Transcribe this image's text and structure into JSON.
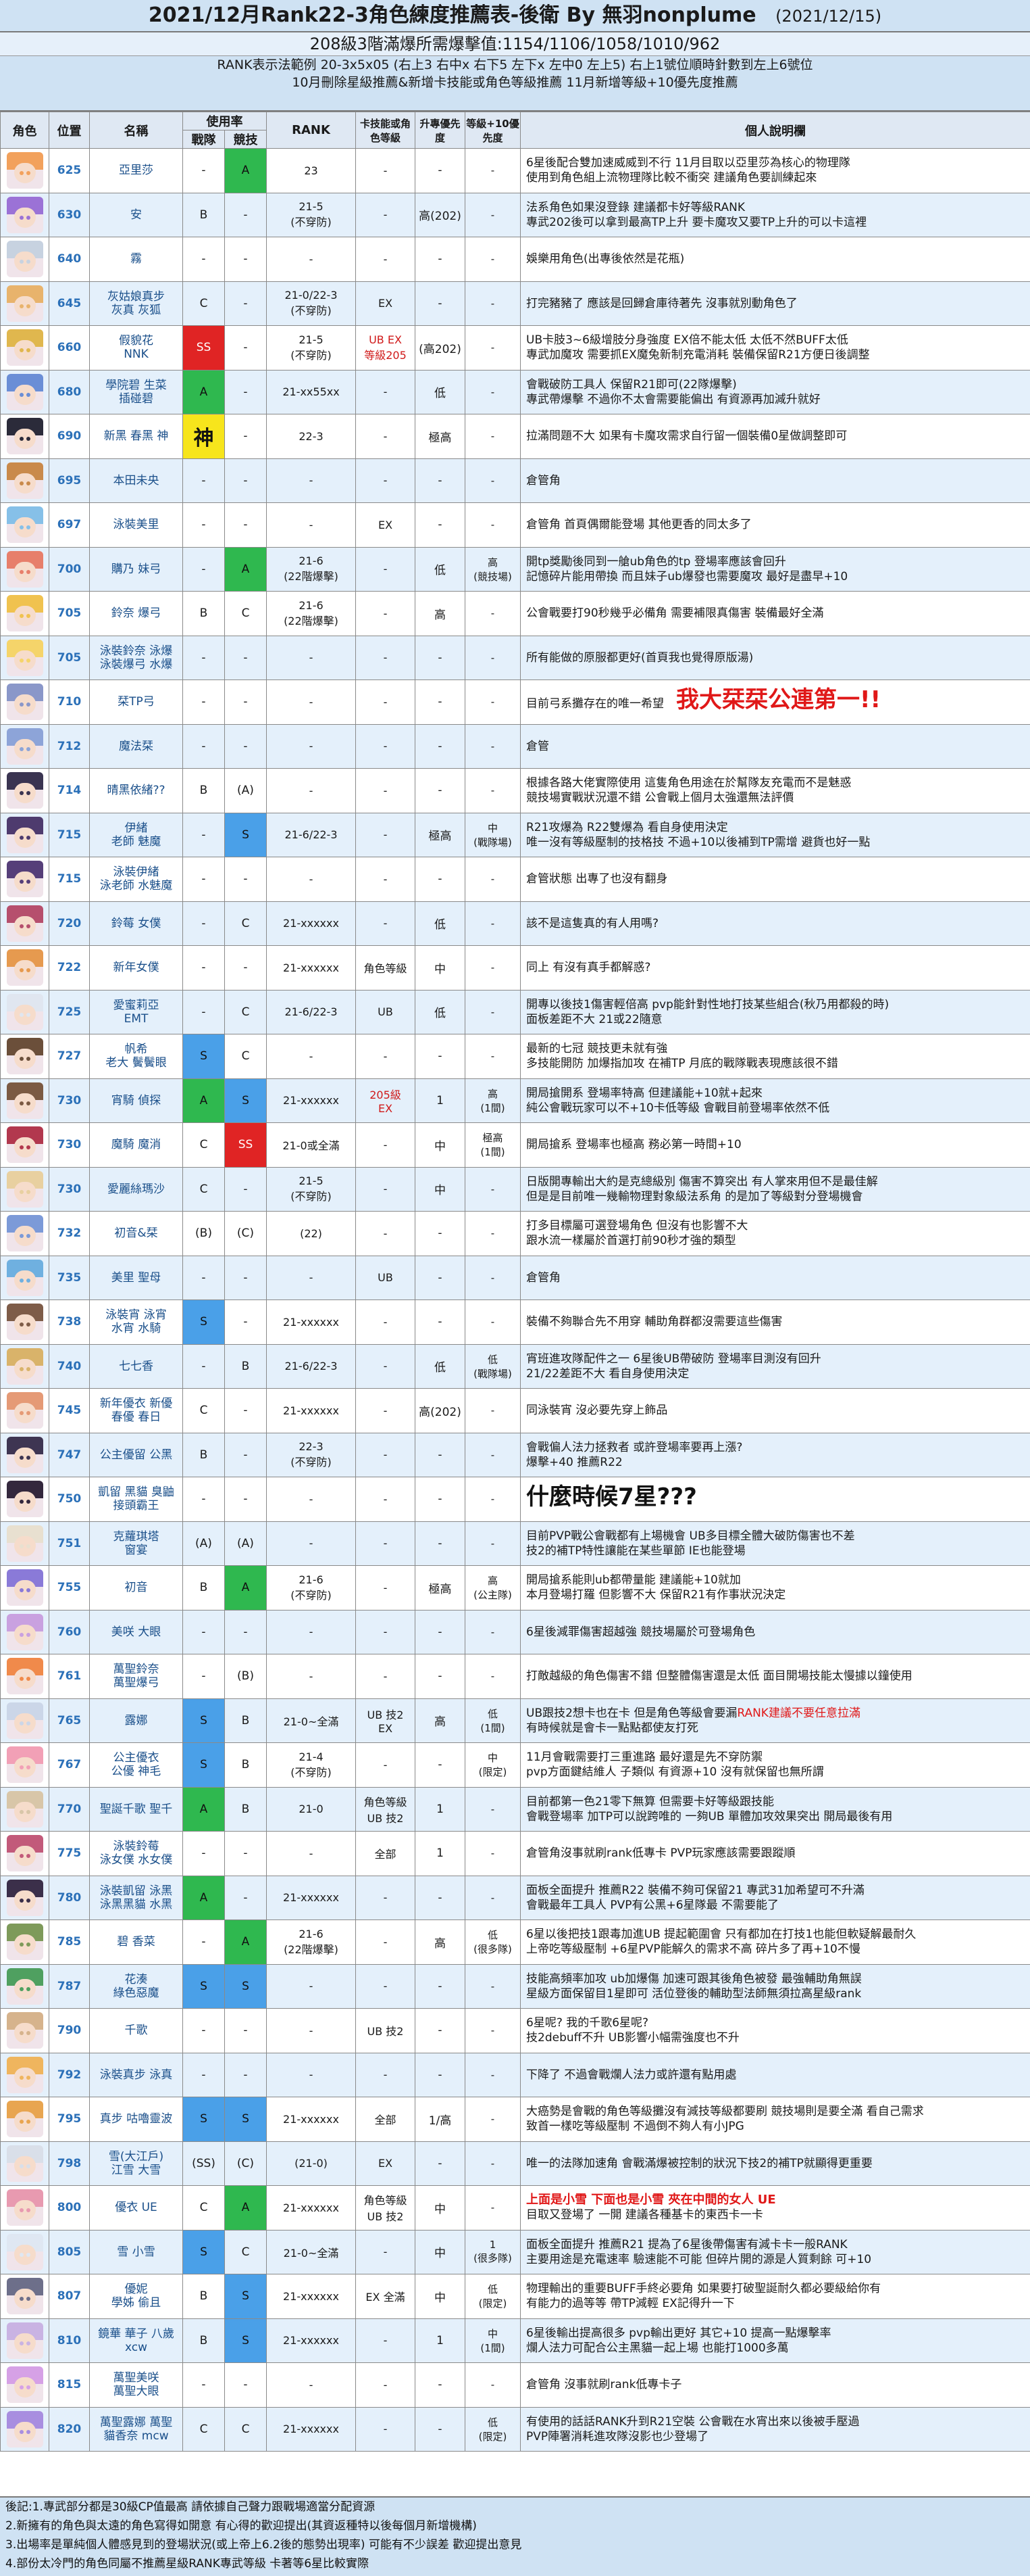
{
  "header": {
    "title": "2021/12月Rank22-3角色練度推薦表-後衛 By 無羽nonplume",
    "date": "(2021/12/15)",
    "subtitle": "208級3階滿爆所需爆擊值:1154/1106/1058/1010/962",
    "info_lines": [
      "RANK表示法範例 20-3x5x05 (右上3 右中x 右下5 左下x 左中0 左上5) 右上1號位順時針數到左上6號位",
      "10月刪除星級推薦&新增卡技能或角色等級推薦 11月新增等級+10優先度推薦"
    ]
  },
  "columns": {
    "avatar": "角色",
    "position": "位置",
    "name": "名稱",
    "usage": "使用率",
    "usage_battle": "戰隊",
    "usage_arena": "競技",
    "rank": "RANK",
    "card": "卡技能或角色等級",
    "uniq": "升專優先度",
    "lv10": "等級+10優先度",
    "note": "個人說明欄"
  },
  "rows": [
    {
      "pos": "625",
      "name": "亞里莎",
      "battle": "-",
      "arena": "A",
      "rank": "23",
      "card": "-",
      "uniq": "-",
      "lv10": "-",
      "note": "6星後配合雙加速威威到不行 11月目取以亞里莎為核心的物理隊\n使用到角色組上流物理隊比較不衝突 建議角色要訓練起來",
      "hair": "#f2a15c"
    },
    {
      "pos": "630",
      "name": "安",
      "battle": "B",
      "arena": "-",
      "rank": "21-5\n(不穿防)",
      "card": "-",
      "uniq": "高(202)",
      "lv10": "-",
      "note": "法系角色如果沒登錄 建議都卡好等級RANK\n專武202後可以拿到最高TP上升 要卡魔攻又要TP上升的可以卡這裡",
      "hair": "#9b72d6"
    },
    {
      "pos": "640",
      "name": "霧",
      "battle": "-",
      "arena": "-",
      "rank": "-",
      "card": "-",
      "uniq": "-",
      "lv10": "-",
      "note": "娛樂用角色(出專後依然是花瓶)",
      "hair": "#c7d2e0"
    },
    {
      "pos": "645",
      "name": "灰姑娘真步\n灰真 灰狐",
      "battle": "C",
      "arena": "-",
      "rank": "21-0/22-3\n(不穿防)",
      "card": "EX",
      "uniq": "-",
      "lv10": "-",
      "note": "打完豬豬了 應該是回歸倉庫待著先 沒事就別動角色了",
      "hair": "#e8b36c"
    },
    {
      "pos": "660",
      "name": "假貌花\nNNK",
      "battle": "SS",
      "arena": "-",
      "rank": "21-5\n(不穿防)",
      "card": "UB EX\n等級205",
      "uniq": "(高202)",
      "lv10": "-",
      "note": "UB卡肢3~6級增肢分身強度 EX倍不能太低 太低不然BUFF太低\n專武加魔攻 需要抓EX魔兔新制充電消耗 裝備保留R21方便日後調整",
      "hair": "#e0b74e"
    },
    {
      "pos": "680",
      "name": "學院碧 生菜\n插碰碧",
      "battle": "A",
      "arena": "-",
      "rank": "21-xx55xx",
      "card": "-",
      "uniq": "低",
      "lv10": "-",
      "note": "會戰破防工具人 保留R21即可(22隊爆擊)\n專武帶爆擊 不過你不太會需要能偏出 有資源再加減升就好",
      "hair": "#6a8ed6"
    },
    {
      "pos": "690",
      "name": "新黑 春黑 神",
      "battle": "神",
      "arena": "-",
      "rank": "22-3",
      "card": "-",
      "uniq": "極高",
      "lv10": "-",
      "note": "拉滿問題不大 如果有卡魔攻需求自行留一個裝備0星做調整即可",
      "hair": "#2b2b3a"
    },
    {
      "pos": "695",
      "name": "本田未央",
      "battle": "-",
      "arena": "-",
      "rank": "-",
      "card": "-",
      "uniq": "-",
      "lv10": "-",
      "note": "倉管角",
      "hair": "#c98a4b"
    },
    {
      "pos": "697",
      "name": "泳裝美里",
      "battle": "-",
      "arena": "-",
      "rank": "-",
      "card": "EX",
      "uniq": "-",
      "lv10": "-",
      "note": "倉管角 首頁偶爾能登場 其他更香的同太多了",
      "hair": "#86c0e8"
    },
    {
      "pos": "700",
      "name": "購乃 妹弓",
      "battle": "-",
      "arena": "A",
      "rank": "21-6\n(22階爆擊)",
      "card": "-",
      "uniq": "低",
      "lv10": "高\n(競技場)",
      "note": "開tp獎勵後同到一艙ub角色的tp 登場率應該會回升\n記憶碎片能用帶換 而且妹子ub爆發也需要魔攻 最好是盡早+10",
      "hair": "#e77f6b"
    },
    {
      "pos": "705",
      "name": "鈴奈 爆弓",
      "battle": "B",
      "arena": "C",
      "rank": "21-6\n(22階爆擊)",
      "card": "-",
      "uniq": "高",
      "lv10": "-",
      "note": "公會戰要打90秒幾乎必備角 需要補限真傷害 裝備最好全滿",
      "hair": "#f0c24f"
    },
    {
      "pos": "705",
      "name": "泳裝鈴奈 泳爆\n泳裝爆弓 水爆",
      "battle": "-",
      "arena": "-",
      "rank": "-",
      "card": "-",
      "uniq": "-",
      "lv10": "-",
      "note": "所有能做的原服都更好(首頁我也覺得原版湯)",
      "hair": "#f5d46a"
    },
    {
      "pos": "710",
      "name": "栞TP弓",
      "battle": "-",
      "arena": "-",
      "rank": "-",
      "card": "-",
      "uniq": "-",
      "lv10": "-",
      "note": "目前弓系攤存在的唯一希望",
      "bignote": "我大栞栞公連第一!!",
      "hair": "#8a97c9"
    },
    {
      "pos": "712",
      "name": "魔法栞",
      "battle": "-",
      "arena": "-",
      "rank": "-",
      "card": "-",
      "uniq": "-",
      "lv10": "-",
      "note": "倉管",
      "hair": "#8da4d8"
    },
    {
      "pos": "714",
      "name": "晴黑依緒??",
      "battle": "B",
      "arena": "(A)",
      "rank": "-",
      "card": "-",
      "uniq": "-",
      "lv10": "-",
      "note": "根據各路大佬實際使用 這隻角色用途在於幫隊友充電而不是魅惑\n競技場實戰狀況還不錯 公會戰上個月太強還無法評價",
      "hair": "#3a3451"
    },
    {
      "pos": "715",
      "name": "伊緒\n老師 魅魔",
      "battle": "-",
      "arena": "S",
      "rank": "21-6/22-3",
      "card": "-",
      "uniq": "極高",
      "lv10": "中\n(戰隊場)",
      "note": "R21攻爆為 R22雙爆為 看自身使用決定\n唯一沒有等級壓制的技格技 不過+10以後補到TP需增 避貨也好一點",
      "hair": "#4e3b6e"
    },
    {
      "pos": "715",
      "name": "泳裝伊緒\n泳老師 水魅魔",
      "battle": "-",
      "arena": "-",
      "rank": "-",
      "card": "-",
      "uniq": "-",
      "lv10": "-",
      "note": "倉管狀態 出專了也沒有翻身",
      "hair": "#563f79"
    },
    {
      "pos": "720",
      "name": "鈴莓 女僕",
      "battle": "-",
      "arena": "C",
      "rank": "21-xxxxxx",
      "card": "-",
      "uniq": "低",
      "lv10": "-",
      "note": "該不是這隻真的有人用嗎?",
      "hair": "#b64f6d"
    },
    {
      "pos": "722",
      "name": "新年女僕",
      "battle": "-",
      "arena": "-",
      "rank": "21-xxxxxx",
      "card": "角色等級",
      "uniq": "中",
      "lv10": "-",
      "note": "同上 有沒有真手都解惑?",
      "hair": "#e69a4f"
    },
    {
      "pos": "725",
      "name": "愛蜜莉亞\nEMT",
      "battle": "-",
      "arena": "C",
      "rank": "21-6/22-3",
      "card": "UB",
      "uniq": "低",
      "lv10": "-",
      "note": "開專以後技1傷害輕倍高 pvp能針對性地打技某些組合(秋乃用都殺的時)\n面板差距不大 21或22隨意",
      "hair": "#e0e6f0"
    },
    {
      "pos": "727",
      "name": "帆希\n老大 鬢鬢眼",
      "battle": "S",
      "arena": "C",
      "rank": "-",
      "card": "-",
      "uniq": "-",
      "lv10": "-",
      "note": "最新的七冠 競技更未就有強\n多技能開防 加爆指加攻 在補TP 月底的戰隊戰表現應該很不錯",
      "hair": "#6b4f3a"
    },
    {
      "pos": "730",
      "name": "宵騎 偵探",
      "battle": "A",
      "arena": "S",
      "rank": "21-xxxxxx",
      "card": "205級\nEX",
      "uniq": "1",
      "lv10": "高\n(1間)",
      "note": "開局搶開系 登場率特高 但建議能+10就+起來\n純公會戰玩家可以不+10卡低等級 會戰目前登場率依然不低",
      "hair": "#7b5a43"
    },
    {
      "pos": "730",
      "name": "魔騎 魔消",
      "battle": "C",
      "arena": "SS",
      "rank": "21-0或全滿",
      "card": "-",
      "uniq": "中",
      "lv10": "極高\n(1間)",
      "note": "開局搶系 登場率也極高 務必第一時間+10",
      "hair": "#b2384e"
    },
    {
      "pos": "730",
      "name": "愛麗絲瑪沙",
      "battle": "C",
      "arena": "-",
      "rank": "21-5\n(不穿防)",
      "card": "-",
      "uniq": "中",
      "lv10": "-",
      "note": "日版開專輸出大約是克總級別 傷害不算突出 有人掌來用但不是最佳解\n但是是目前唯一幾輸物理對象級法系角 的是加了等級對分登場機會",
      "hair": "#e8d0a0"
    },
    {
      "pos": "732",
      "name": "初音&栞",
      "battle": "(B)",
      "arena": "(C)",
      "rank": "(22)",
      "card": "-",
      "uniq": "-",
      "lv10": "-",
      "note": "打多目標屬可選登場角色 但沒有也影響不大\n跟水流一樣屬於首選打前90秒才強的類型",
      "hair": "#7c9ad8"
    },
    {
      "pos": "735",
      "name": "美里 聖母",
      "battle": "-",
      "arena": "-",
      "rank": "-",
      "card": "UB",
      "uniq": "-",
      "lv10": "-",
      "note": "倉管角",
      "hair": "#6fb0e0"
    },
    {
      "pos": "738",
      "name": "泳裝宵 泳宵\n水宵 水騎",
      "battle": "S",
      "arena": "-",
      "rank": "21-xxxxxx",
      "card": "-",
      "uniq": "-",
      "lv10": "-",
      "note": "裝備不夠聯合先不用穿 輔助角群都沒需要這些傷害",
      "hair": "#7e5c48"
    },
    {
      "pos": "740",
      "name": "七七香",
      "battle": "-",
      "arena": "B",
      "rank": "21-6/22-3",
      "card": "-",
      "uniq": "低",
      "lv10": "低\n(戰隊場)",
      "note": "宵班進攻隊配件之一 6星後UB帶破防 登場率目測沒有回升\n21/22差距不大 看自身使用決定",
      "hair": "#d9b36a"
    },
    {
      "pos": "745",
      "name": "新年優衣 新優\n春優 春日",
      "battle": "C",
      "arena": "-",
      "rank": "21-xxxxxx",
      "card": "-",
      "uniq": "高(202)",
      "lv10": "-",
      "note": "同泳裝宵 沒必要先穿上飾品",
      "hair": "#e59a76"
    },
    {
      "pos": "747",
      "name": "公主優留 公黑",
      "battle": "B",
      "arena": "-",
      "rank": "22-3\n(不穿防)",
      "card": "-",
      "uniq": "-",
      "lv10": "-",
      "note": "會戰偏人法力拯救者 或許登場率要再上漲?\n爆擊+40 推薦R22",
      "hair": "#3e3552"
    },
    {
      "pos": "750",
      "name": "凱留 黑貓 臭鼬\n接頭霸王",
      "battle": "-",
      "arena": "-",
      "rank": "-",
      "card": "-",
      "uniq": "-",
      "lv10": "-",
      "note": "",
      "bignote2": "什麼時候7星???",
      "hair": "#34283d"
    },
    {
      "pos": "751",
      "name": "克蘿琪塔\n窗宴",
      "battle": "(A)",
      "arena": "(A)",
      "rank": "-",
      "card": "-",
      "uniq": "-",
      "lv10": "-",
      "note": "目前PVP戰公會戰都有上場機會 UB多目標全體大破防傷害也不差\n技2的補TP特性讓能在某些單節 IE也能登場",
      "hair": "#e8e0d0"
    },
    {
      "pos": "755",
      "name": "初音",
      "battle": "B",
      "arena": "A",
      "rank": "21-6\n(不穿防)",
      "card": "-",
      "uniq": "極高",
      "lv10": "高\n(公主隊)",
      "note": "開局搶系能則ub都帶量能 建議能+10就加\n本月登場打羅 但影響不大 保留R21有作事狀況決定",
      "hair": "#8a7ad8"
    },
    {
      "pos": "760",
      "name": "美咲 大眼",
      "battle": "-",
      "arena": "-",
      "rank": "-",
      "card": "-",
      "uniq": "-",
      "lv10": "-",
      "note": "6星後減罪傷害超越強 競技場屬於可登場角色",
      "hair": "#c9a1e0"
    },
    {
      "pos": "761",
      "name": "萬聖鈴奈\n萬聖爆弓",
      "battle": "-",
      "arena": "(B)",
      "rank": "-",
      "card": "-",
      "uniq": "-",
      "lv10": "-",
      "note": "打敵越級的角色傷害不錯 但整體傷害還是太低 面目開場技能太慢據以鐘使用",
      "hair": "#f08a4b"
    },
    {
      "pos": "765",
      "name": "露娜",
      "battle": "S",
      "arena": "B",
      "rank": "21-0~全滿",
      "card": "UB 技2\nEX",
      "uniq": "高",
      "lv10": "低\n(1間)",
      "note": "UB跟技2想卡也在卡 但是角色等級會要漏",
      "rednote": "RANK建議不要任意拉滿",
      "note2": "有時候就是會卡一點點都使友打死",
      "hair": "#cbd6e8"
    },
    {
      "pos": "767",
      "name": "公主優衣\n公優 神毛",
      "battle": "S",
      "arena": "B",
      "rank": "21-4\n(不穿防)",
      "card": "-",
      "uniq": "-",
      "lv10": "中\n(限定)",
      "note": "11月會戰需要打三重進路 最好還是先不穿防禦\npvp方面鍵結維人 子類似 有資源+10 沒有就保留也無所謂",
      "hair": "#f2a0b6"
    },
    {
      "pos": "770",
      "name": "聖誕千歌 聖千",
      "battle": "A",
      "arena": "B",
      "rank": "21-0",
      "card": "角色等級\nUB 技2",
      "uniq": "1",
      "lv10": "-",
      "note": "目前都第一色21零下無算 但需要卡好等級跟技能\n會戰登場率 加TP可以說跨唯的 一夠UB 單體加攻效果突出 開局最後有用",
      "hair": "#d8c6a8"
    },
    {
      "pos": "775",
      "name": "泳裝鈴莓\n泳女僕 水女僕",
      "battle": "-",
      "arena": "-",
      "rank": "-",
      "card": "全部",
      "uniq": "1",
      "lv10": "-",
      "note": "倉管角沒事就刷rank低專卡 PVP玩家應該需要跟蹤順",
      "hair": "#c25a7a"
    },
    {
      "pos": "780",
      "name": "泳裝凱留 泳黑\n泳黑黑貓 水黑",
      "battle": "A",
      "arena": "-",
      "rank": "21-xxxxxx",
      "card": "-",
      "uniq": "-",
      "lv10": "-",
      "note": "面板全面提升 推薦R22 裝備不夠可保留21 專武31加希望可不升滿\n會戰最年工具人 PVP有公黑+6星隊最 不需要能了",
      "hair": "#3b2f4a"
    },
    {
      "pos": "785",
      "name": "碧 香菜",
      "battle": "-",
      "arena": "A",
      "rank": "21-6\n(22階爆擊)",
      "card": "-",
      "uniq": "高",
      "lv10": "低\n(很多隊)",
      "note": "6星以後把技1跟毒加進UB 提起範圍會 只有都加在打技1也能但軟疑解最耐久\n上帝吃等級壓制 +6星PVP能解久的需求不高 碎片多了再+10不慢",
      "hair": "#7e9a5a"
    },
    {
      "pos": "787",
      "name": "花湊\n綠色惡魔",
      "battle": "S",
      "arena": "S",
      "rank": "-",
      "card": "-",
      "uniq": "-",
      "lv10": "-",
      "note": "技能高頻率加攻 ub加爆傷 加速可跟其後角色被發 最強輔助角無誤\n星級方面保留目1星即可 活位登後的輔助型法師無須拉高星級rank",
      "hair": "#4fa060"
    },
    {
      "pos": "790",
      "name": "千歌",
      "battle": "-",
      "arena": "-",
      "rank": "-",
      "card": "UB 技2",
      "uniq": "-",
      "lv10": "-",
      "note": "6星呢? 我的千歌6星呢?\n技2debuff不升 UB影響小幅需強度也不升",
      "hair": "#d6b38c"
    },
    {
      "pos": "792",
      "name": "泳裝真步 泳真",
      "battle": "-",
      "arena": "-",
      "rank": "-",
      "card": "-",
      "uniq": "-",
      "lv10": "-",
      "note": "下降了 不過會戰爛人法力或許還有點用處",
      "hair": "#efb55e"
    },
    {
      "pos": "795",
      "name": "真步 咕嚕靈波",
      "battle": "S",
      "arena": "S",
      "rank": "21-xxxxxx",
      "card": "全部",
      "uniq": "1/高",
      "lv10": "-",
      "note": "大癌勢是會戰的角色等級攤沒有減技等級都要刷 競技場則是要全滿 看自己需求\n致首一樣吃等級壓制 不過倒不夠人有小JPG",
      "hair": "#e8a550"
    },
    {
      "pos": "798",
      "name": "雪(大江戶)\n江雪 大雪",
      "battle": "(SS)",
      "arena": "(C)",
      "rank": "(21-0)",
      "card": "EX",
      "uniq": "-",
      "lv10": "-",
      "note": "唯一的法隊加速角 會戰滿爆被控制的狀況下技2的補TP就顯得更重要",
      "hair": "#d9dfe9"
    },
    {
      "pos": "800",
      "name": "優衣 UE",
      "battle": "C",
      "arena": "A",
      "rank": "21-xxxxxx",
      "card": "角色等級\nUB 技2",
      "uniq": "中",
      "lv10": "-",
      "note": "",
      "rednote": "上面是小雪 下面也是小雪 夾在中間的女人 UE",
      "note2": "目取又登場了 一開 建議各種基卡的東西卡一卡",
      "hair": "#e89ab0"
    },
    {
      "pos": "805",
      "name": "雪 小雪",
      "battle": "S",
      "arena": "C",
      "rank": "21-0~全滿",
      "card": "-",
      "uniq": "中",
      "lv10": "1\n(很多隊)",
      "note": "面板全面提升 推薦R21 提為了6星後帶傷害有減卡卡一般RANK\n主要用途是充電速率 驗速能不可能 但碎片開的源是人質剩餘 可+10",
      "hair": "#dfe7f2"
    },
    {
      "pos": "807",
      "name": "優妮\n學姊 偷且",
      "battle": "B",
      "arena": "S",
      "rank": "21-xxxxxx",
      "card": "EX 全滿",
      "uniq": "中",
      "lv10": "低\n(限定)",
      "note": "物理輸出的重要BUFF手終必要角 如果要打破聖誕耐久都必要級給你有\n有能力的過等等 帶TP減輕 EX記得升一下",
      "hair": "#6d6f8a"
    },
    {
      "pos": "810",
      "name": "鏡華 華子 八歲\nxcw",
      "battle": "B",
      "arena": "S",
      "rank": "21-xxxxxx",
      "card": "-",
      "uniq": "1",
      "lv10": "中\n(1間)",
      "note": "6星後輸出提高很多 pvp輸出更好 其它+10 提高一點爆擊率\n爛人法力可配合公主黑貓一起上場 也能打1000多萬",
      "hair": "#c9b3e3"
    },
    {
      "pos": "815",
      "name": "萬聖美咲\n萬聖大眼",
      "battle": "-",
      "arena": "-",
      "rank": "-",
      "card": "-",
      "uniq": "-",
      "lv10": "-",
      "note": "倉管角 沒事就刷rank低專卡子",
      "hair": "#d6a1e6"
    },
    {
      "pos": "820",
      "name": "萬聖露娜 萬聖\n貓香奈 mcw",
      "battle": "C",
      "arena": "C",
      "rank": "21-xxxxxx",
      "card": "-",
      "uniq": "-",
      "lv10": "低\n(限定)",
      "note": "有使用的話話RANK升到R21空裝 公會戰在水宵出來以後被手壓過\nPVP陣署消耗進攻隊沒影也少登場了",
      "hair": "#a88ee0"
    }
  ],
  "footer": [
    "後記:1.專武部分都是30級CP值最高 請依據自己聲力跟戰場適當分配資源",
    "2.新擁有的角色與太遠的角色寫得如開意 有心得的歡迎提出(其資返種特以後每個月新增機構)",
    "3.出場率是單純個人體感見到的登場狀況(或上帝上6.2後的態勢出現率) 可能有不少誤差 歡迎提出意見",
    "4.部份太冷門的角色同屬不推薦星級RANK專武等級 卡著等6星比較實際"
  ]
}
